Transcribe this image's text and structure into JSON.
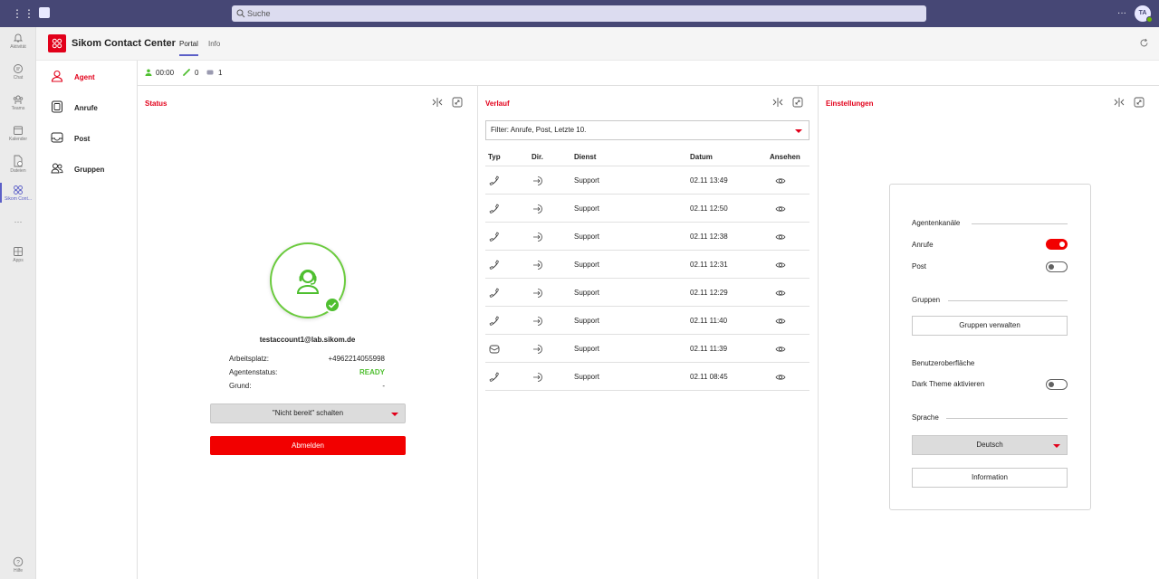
{
  "topbar": {
    "search_placeholder": "Suche",
    "more": "···",
    "avatar_initials": "TA"
  },
  "rail": {
    "items": [
      {
        "label": "Aktivität",
        "icon": "bell-icon"
      },
      {
        "label": "Chat",
        "icon": "chat-icon"
      },
      {
        "label": "Teams",
        "icon": "teams-icon"
      },
      {
        "label": "Kalender",
        "icon": "calendar-icon"
      },
      {
        "label": "Dateien",
        "icon": "files-icon"
      },
      {
        "label": "Sikom Cont...",
        "icon": "app-icon"
      },
      {
        "label": "···",
        "icon": "more-icon"
      },
      {
        "label": "Apps",
        "icon": "apps-icon"
      },
      {
        "label": "Hilfe",
        "icon": "help-icon"
      }
    ]
  },
  "app": {
    "title": "Sikom Contact Center",
    "tabs": [
      "Portal",
      "Info"
    ]
  },
  "nav": {
    "items": [
      "Agent",
      "Anrufe",
      "Post",
      "Gruppen"
    ]
  },
  "status_bar": {
    "time": "00:00",
    "calls": "0",
    "mail": "1"
  },
  "status": {
    "title": "Status",
    "email": "testaccount1@lab.sikom.de",
    "workplace_label": "Arbeitsplatz:",
    "workplace_value": "+4962214055998",
    "agentstatus_label": "Agentenstatus:",
    "agentstatus_value": "READY",
    "reason_label": "Grund:",
    "reason_value": "-",
    "notready_button": "\"Nicht bereit\" schalten",
    "logout_button": "Abmelden"
  },
  "history": {
    "title": "Verlauf",
    "filter": "Filter: Anrufe, Post, Letzte 10.",
    "columns": [
      "Typ",
      "Dir.",
      "Dienst",
      "Datum",
      "Ansehen"
    ],
    "rows": [
      {
        "type": "phone",
        "service": "Support",
        "date": "02.11 13:49"
      },
      {
        "type": "phone",
        "service": "Support",
        "date": "02.11 12:50"
      },
      {
        "type": "phone",
        "service": "Support",
        "date": "02.11 12:38"
      },
      {
        "type": "phone",
        "service": "Support",
        "date": "02.11 12:31"
      },
      {
        "type": "phone",
        "service": "Support",
        "date": "02.11 12:29"
      },
      {
        "type": "phone",
        "service": "Support",
        "date": "02.11 11:40"
      },
      {
        "type": "mail",
        "service": "Support",
        "date": "02.11 11:39"
      },
      {
        "type": "phone",
        "service": "Support",
        "date": "02.11 08:45"
      }
    ]
  },
  "settings": {
    "title": "Einstellungen",
    "channels_heading": "Agentenkanäle",
    "calls_label": "Anrufe",
    "calls_on": true,
    "post_label": "Post",
    "post_on": false,
    "groups_heading": "Gruppen",
    "manage_groups": "Gruppen verwalten",
    "ui_heading": "Benutzeroberfläche",
    "dark_theme_label": "Dark Theme aktivieren",
    "dark_theme_on": false,
    "language_heading": "Sprache",
    "language_value": "Deutsch",
    "information_button": "Information"
  },
  "colors": {
    "brand": "#e2001a",
    "teams": "#464775",
    "ready": "#4fbf30"
  }
}
